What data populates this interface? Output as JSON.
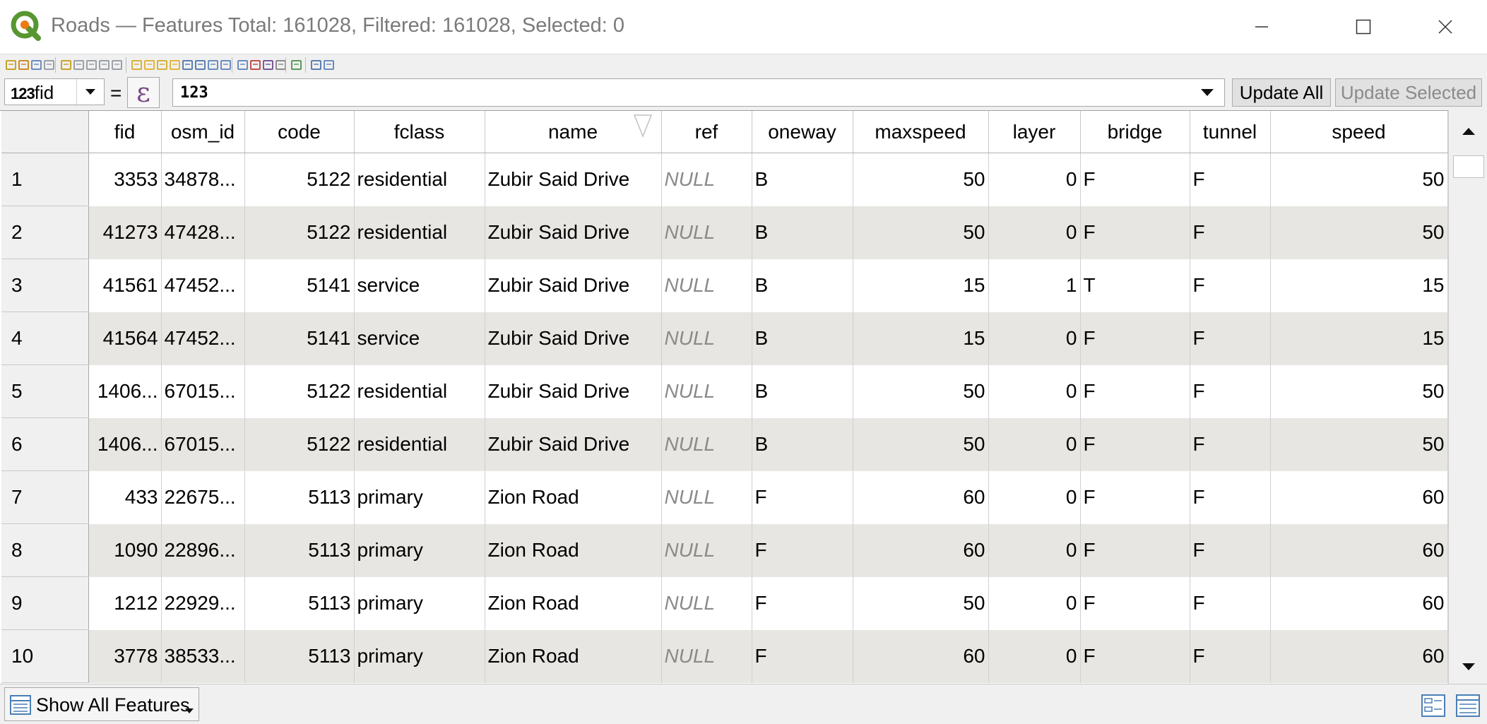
{
  "window": {
    "title": "Roads — Features Total: 161028, Filtered: 161028, Selected: 0"
  },
  "toolbar": {
    "icons": [
      "toggle-editing-icon",
      "multi-edit-icon",
      "save-edits-icon",
      "reload-icon",
      "add-feature-icon",
      "delete-feature-icon",
      "cut-icon",
      "copy-icon",
      "paste-icon",
      "select-expression-icon",
      "select-all-icon",
      "invert-selection-icon",
      "deselect-icon",
      "filter-selected-icon",
      "move-to-top-icon",
      "pan-to-selected-icon",
      "zoom-to-selected-icon",
      "new-field-icon",
      "delete-field-icon",
      "field-calculator-icon",
      "conditional-formatting-icon",
      "actions-icon",
      "dock-icon",
      "organize-columns-icon"
    ]
  },
  "calc": {
    "field_type": "123",
    "field_name": "fid",
    "equals": "=",
    "expression_symbol": "ε",
    "expression": "123",
    "update_all": "Update All",
    "update_selected": "Update Selected"
  },
  "table": {
    "columns": [
      "fid",
      "osm_id",
      "code",
      "fclass",
      "name",
      "ref",
      "oneway",
      "maxspeed",
      "layer",
      "bridge",
      "tunnel",
      "speed"
    ],
    "rows": [
      {
        "n": "1",
        "fid": "3353",
        "osm_id": "34878...",
        "code": "5122",
        "fclass": "residential",
        "name": "Zubir Said Drive",
        "ref": "NULL",
        "oneway": "B",
        "maxspeed": "50",
        "layer": "0",
        "bridge": "F",
        "tunnel": "F",
        "speed": "50"
      },
      {
        "n": "2",
        "fid": "41273",
        "osm_id": "47428...",
        "code": "5122",
        "fclass": "residential",
        "name": "Zubir Said Drive",
        "ref": "NULL",
        "oneway": "B",
        "maxspeed": "50",
        "layer": "0",
        "bridge": "F",
        "tunnel": "F",
        "speed": "50"
      },
      {
        "n": "3",
        "fid": "41561",
        "osm_id": "47452...",
        "code": "5141",
        "fclass": "service",
        "name": "Zubir Said Drive",
        "ref": "NULL",
        "oneway": "B",
        "maxspeed": "15",
        "layer": "1",
        "bridge": "T",
        "tunnel": "F",
        "speed": "15"
      },
      {
        "n": "4",
        "fid": "41564",
        "osm_id": "47452...",
        "code": "5141",
        "fclass": "service",
        "name": "Zubir Said Drive",
        "ref": "NULL",
        "oneway": "B",
        "maxspeed": "15",
        "layer": "0",
        "bridge": "F",
        "tunnel": "F",
        "speed": "15"
      },
      {
        "n": "5",
        "fid": "1406...",
        "osm_id": "67015...",
        "code": "5122",
        "fclass": "residential",
        "name": "Zubir Said Drive",
        "ref": "NULL",
        "oneway": "B",
        "maxspeed": "50",
        "layer": "0",
        "bridge": "F",
        "tunnel": "F",
        "speed": "50"
      },
      {
        "n": "6",
        "fid": "1406...",
        "osm_id": "67015...",
        "code": "5122",
        "fclass": "residential",
        "name": "Zubir Said Drive",
        "ref": "NULL",
        "oneway": "B",
        "maxspeed": "50",
        "layer": "0",
        "bridge": "F",
        "tunnel": "F",
        "speed": "50"
      },
      {
        "n": "7",
        "fid": "433",
        "osm_id": "22675...",
        "code": "5113",
        "fclass": "primary",
        "name": "Zion Road",
        "ref": "NULL",
        "oneway": "F",
        "maxspeed": "60",
        "layer": "0",
        "bridge": "F",
        "tunnel": "F",
        "speed": "60"
      },
      {
        "n": "8",
        "fid": "1090",
        "osm_id": "22896...",
        "code": "5113",
        "fclass": "primary",
        "name": "Zion Road",
        "ref": "NULL",
        "oneway": "F",
        "maxspeed": "60",
        "layer": "0",
        "bridge": "F",
        "tunnel": "F",
        "speed": "60"
      },
      {
        "n": "9",
        "fid": "1212",
        "osm_id": "22929...",
        "code": "5113",
        "fclass": "primary",
        "name": "Zion Road",
        "ref": "NULL",
        "oneway": "F",
        "maxspeed": "50",
        "layer": "0",
        "bridge": "F",
        "tunnel": "F",
        "speed": "60"
      },
      {
        "n": "10",
        "fid": "3778",
        "osm_id": "38533...",
        "code": "5113",
        "fclass": "primary",
        "name": "Zion Road",
        "ref": "NULL",
        "oneway": "F",
        "maxspeed": "60",
        "layer": "0",
        "bridge": "F",
        "tunnel": "F",
        "speed": "60"
      }
    ]
  },
  "bottom": {
    "filter_label": "Show All Features"
  },
  "colors": {
    "alt_row": "#e7e6e2",
    "null_text": "#8a8a8a",
    "logo_green": "#589632",
    "logo_yellow": "#ee7913"
  }
}
